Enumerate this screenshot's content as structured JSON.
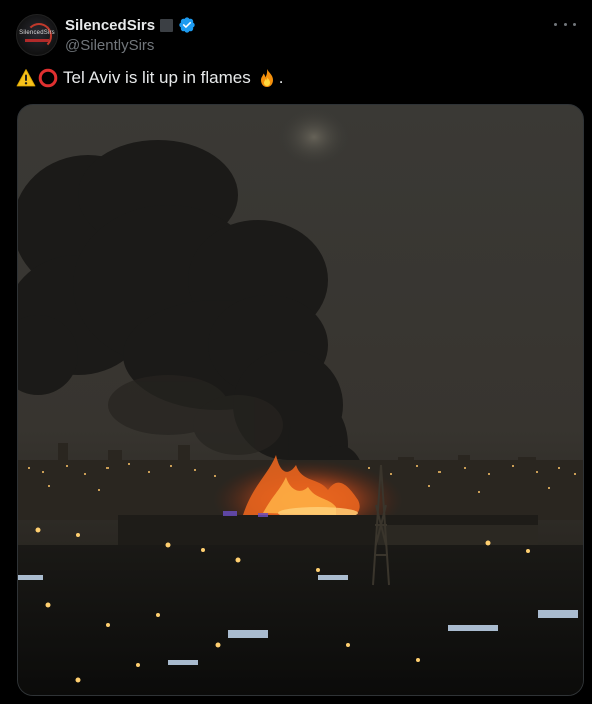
{
  "post": {
    "display_name": "SilencedSirs",
    "handle": "@SilentlySirs",
    "avatar_text": "SilencedSirs",
    "text": "Tel Aviv is lit up in flames",
    "text_suffix": ".",
    "icons": {
      "verified": "verified-badge-icon",
      "more": "more-options-icon",
      "warning": "warning-emoji-icon",
      "circle": "red-circle-emoji-icon",
      "fire": "fire-emoji-icon"
    },
    "media": {
      "type": "photo",
      "subject": "night city skyline with fire and black smoke plume"
    }
  },
  "colors": {
    "background": "#000000",
    "text": "#e7e9ea",
    "secondary_text": "#71767b",
    "verified_blue": "#1d9bf0",
    "border": "#2f3336"
  }
}
